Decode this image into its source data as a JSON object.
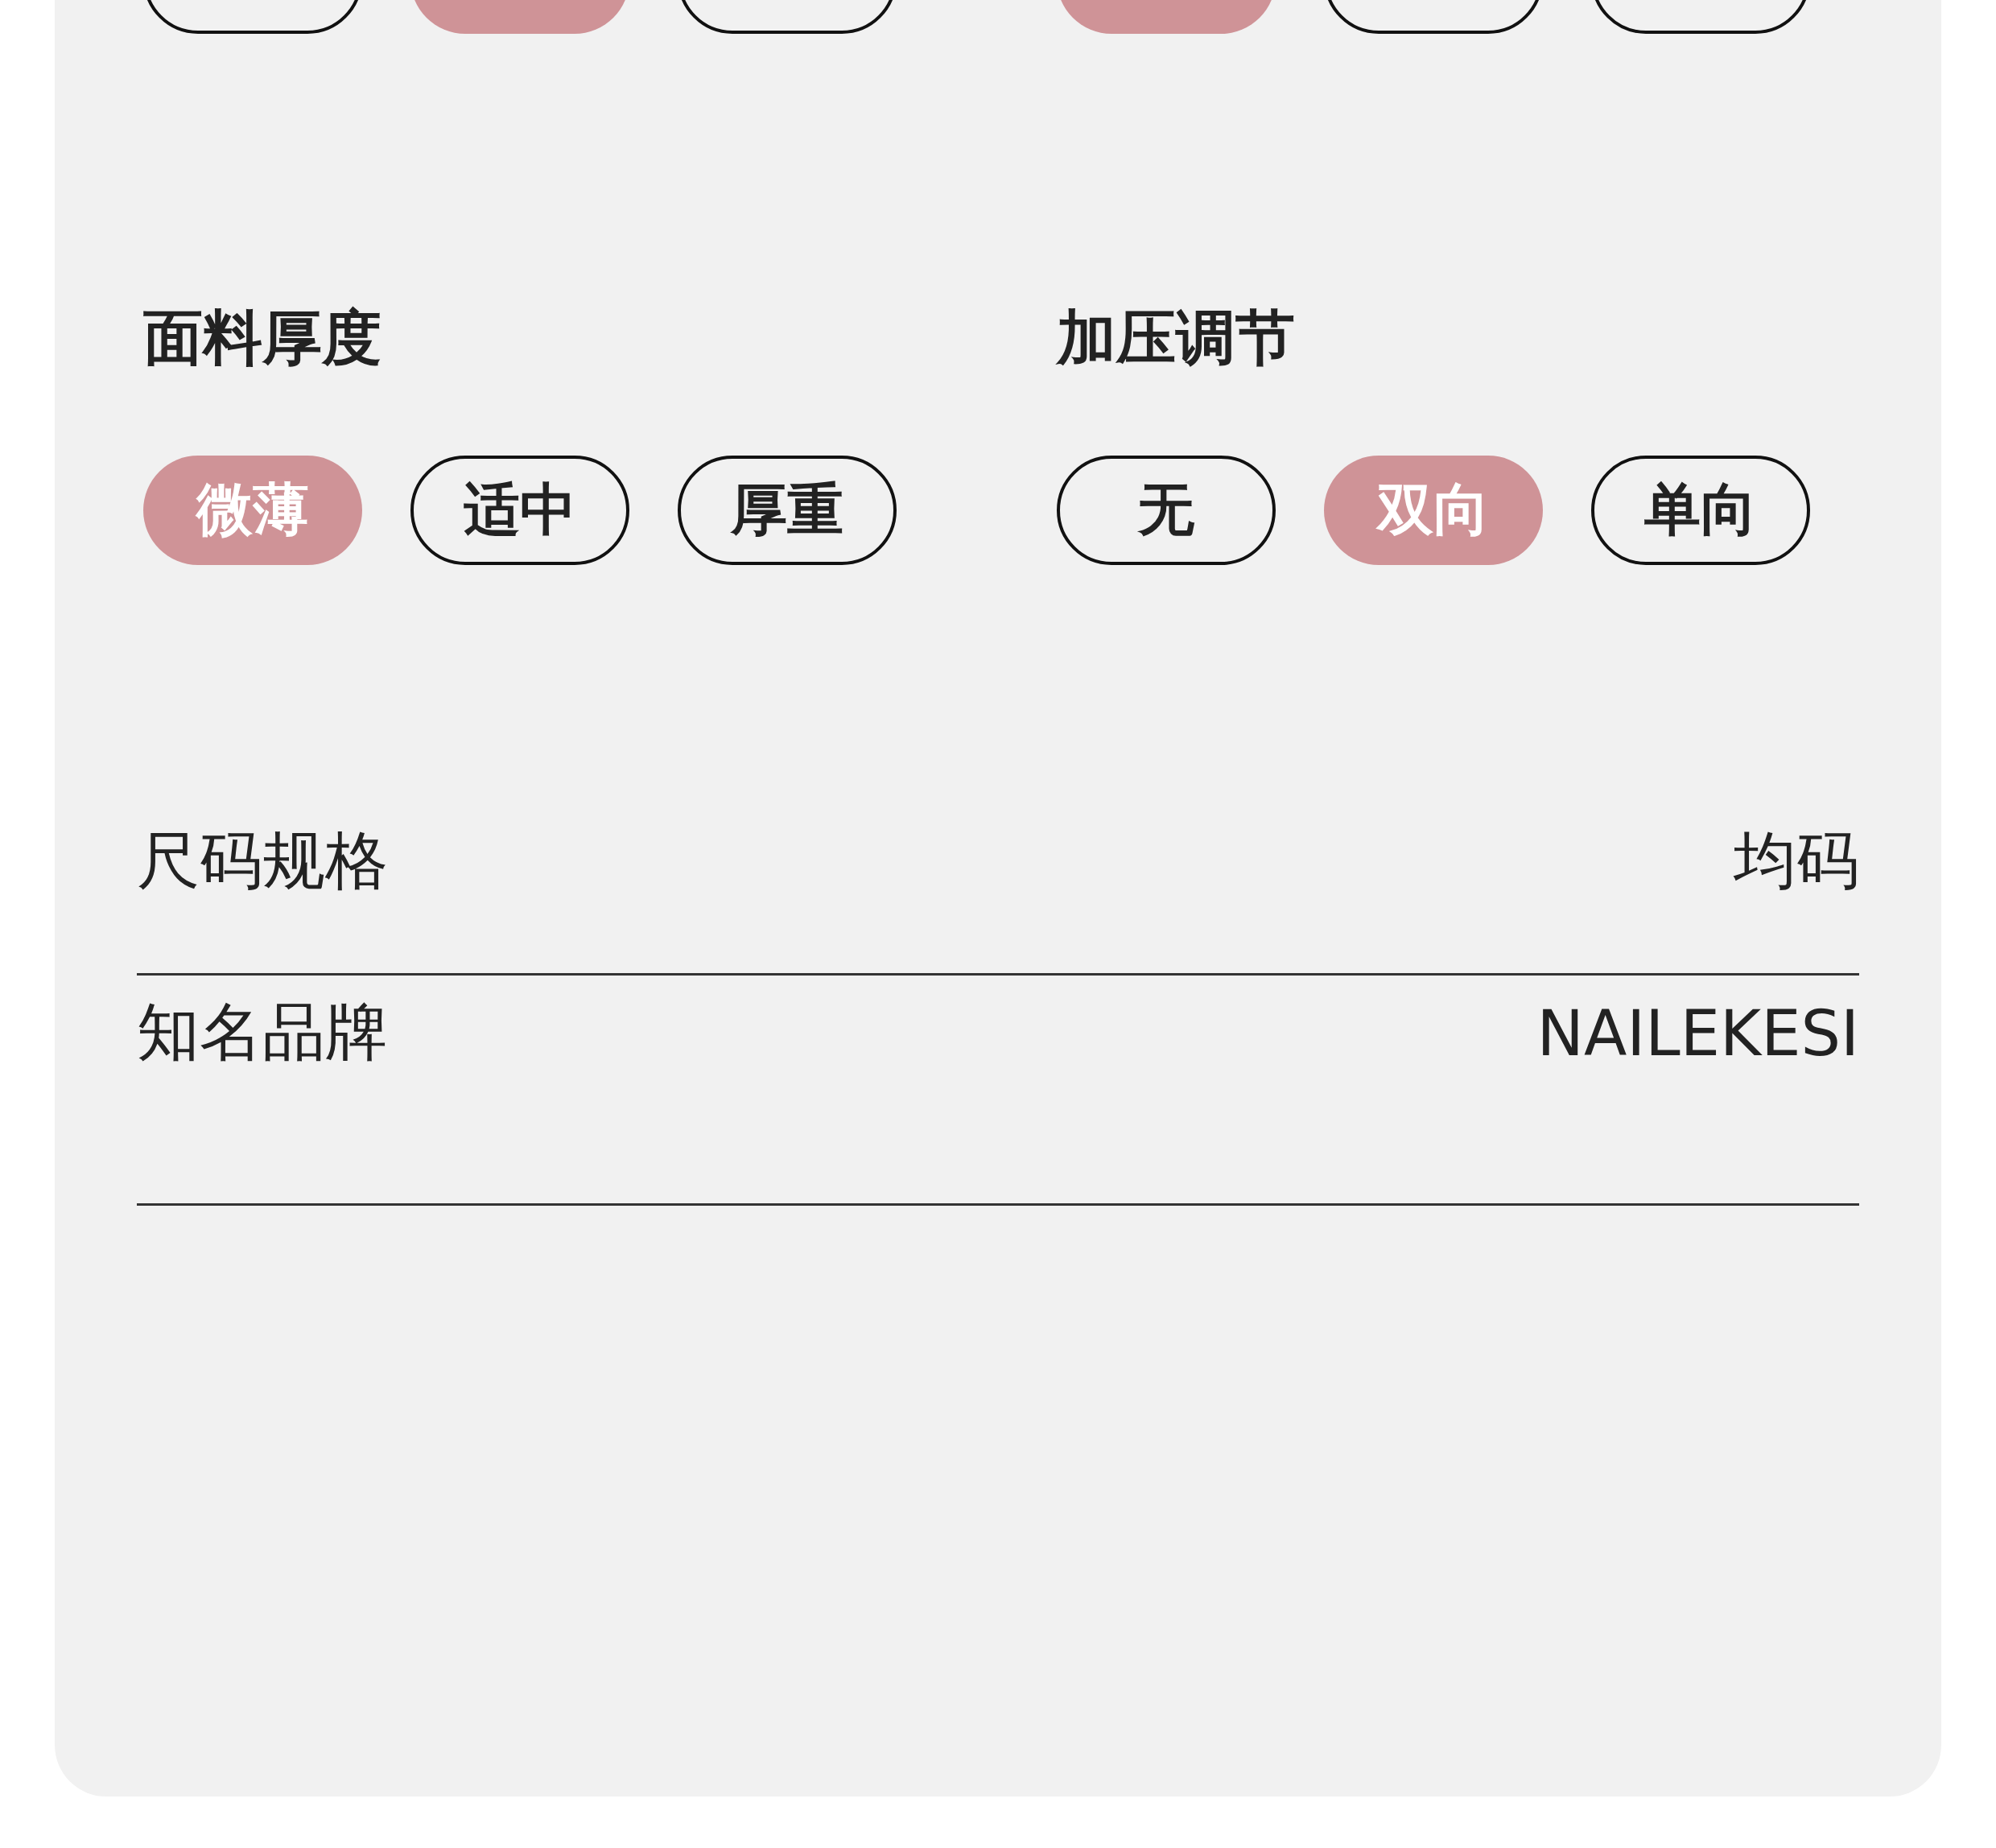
{
  "top_groups": [
    {
      "options": [
        {
          "selected": false
        },
        {
          "selected": true
        },
        {
          "selected": false
        }
      ]
    },
    {
      "options": [
        {
          "selected": true
        },
        {
          "selected": false
        },
        {
          "selected": false
        }
      ]
    }
  ],
  "groups": [
    {
      "title": "面料厚度",
      "options": [
        {
          "label": "微薄",
          "selected": true
        },
        {
          "label": "适中",
          "selected": false
        },
        {
          "label": "厚重",
          "selected": false
        }
      ]
    },
    {
      "title": "加压调节",
      "options": [
        {
          "label": "无",
          "selected": false
        },
        {
          "label": "双向",
          "selected": true
        },
        {
          "label": "单向",
          "selected": false
        }
      ]
    }
  ],
  "specs": [
    {
      "label": "尺码规格",
      "value": "均码"
    },
    {
      "label": "知名品牌",
      "value": "NAILEKESI"
    }
  ]
}
